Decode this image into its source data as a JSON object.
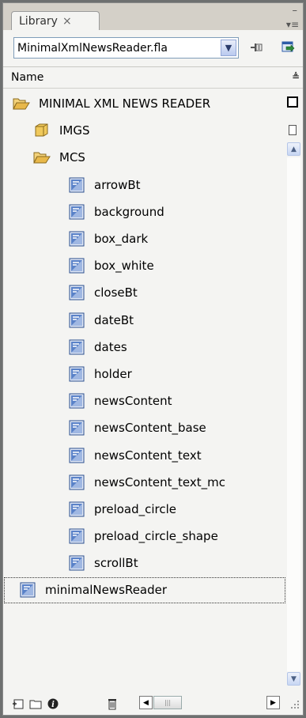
{
  "panel": {
    "tab_label": "Library",
    "tab_close": "×",
    "minimize_glyph": "–",
    "options_glyph": "▾≡"
  },
  "doc": {
    "selected": "MinimalXmlNewsReader.fla",
    "dropdown_glyph": "▼"
  },
  "list": {
    "header": "Name",
    "sort_glyph": "≜",
    "items": [
      {
        "label": "MINIMAL XML NEWS READER",
        "type": "folder-open",
        "indent": 0
      },
      {
        "label": "IMGS",
        "type": "folder",
        "indent": 1
      },
      {
        "label": "MCS",
        "type": "folder-open",
        "indent": 1
      },
      {
        "label": "arrowBt",
        "type": "movieclip",
        "indent": 2
      },
      {
        "label": "background",
        "type": "movieclip",
        "indent": 2
      },
      {
        "label": "box_dark",
        "type": "movieclip",
        "indent": 2
      },
      {
        "label": "box_white",
        "type": "movieclip",
        "indent": 2
      },
      {
        "label": "closeBt",
        "type": "movieclip",
        "indent": 2
      },
      {
        "label": "dateBt",
        "type": "movieclip",
        "indent": 2
      },
      {
        "label": "dates",
        "type": "movieclip",
        "indent": 2
      },
      {
        "label": "holder",
        "type": "movieclip",
        "indent": 2
      },
      {
        "label": "newsContent",
        "type": "movieclip",
        "indent": 2
      },
      {
        "label": "newsContent_base",
        "type": "movieclip",
        "indent": 2
      },
      {
        "label": "newsContent_text",
        "type": "movieclip",
        "indent": 2
      },
      {
        "label": "newsContent_text_mc",
        "type": "movieclip",
        "indent": 2
      },
      {
        "label": "preload_circle",
        "type": "movieclip",
        "indent": 2
      },
      {
        "label": "preload_circle_shape",
        "type": "movieclip",
        "indent": 2
      },
      {
        "label": "scrollBt",
        "type": "movieclip",
        "indent": 2
      },
      {
        "label": "minimalNewsReader",
        "type": "movieclip",
        "indent": 1,
        "selected": true
      }
    ]
  },
  "colors": {
    "folder": "#e8b84a",
    "movieclip": "#3a66b0",
    "background": "#f4f4f2"
  }
}
